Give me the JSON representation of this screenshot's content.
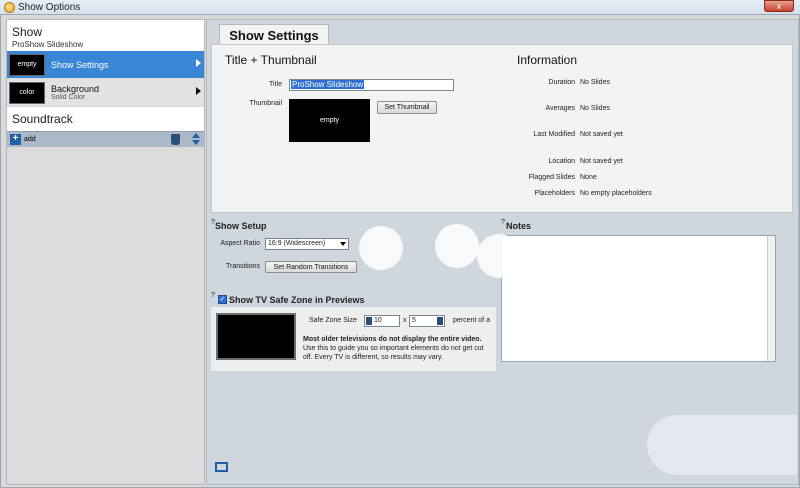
{
  "window": {
    "title": "Show Options",
    "close_label": "x"
  },
  "sidebar": {
    "show": {
      "title": "Show",
      "subtitle": "ProShow Slideshow"
    },
    "items": [
      {
        "thumb": "empty",
        "label": "Show Settings",
        "sub": ""
      },
      {
        "thumb": "color",
        "label": "Background",
        "sub": "Solid Color"
      }
    ],
    "soundtrack": "Soundtrack",
    "add_label": "add"
  },
  "tab": {
    "label": "Show Settings"
  },
  "title_thumb": {
    "heading": "Title + Thumbnail",
    "title_label": "Title",
    "title_value": "ProShow Slideshow",
    "thumbnail_label": "Thumbnail",
    "thumbnail_text": "empty",
    "set_thumbnail_button": "Set Thumbnail"
  },
  "information": {
    "heading": "Information",
    "rows": [
      {
        "label": "Duration",
        "value": "No Slides"
      },
      {
        "label": "Averages",
        "value": "No Slides"
      },
      {
        "label": "Last Modified",
        "value": "Not saved yet"
      },
      {
        "label": "Location",
        "value": "Not saved yet"
      },
      {
        "label": "Flagged Slides",
        "value": "None"
      },
      {
        "label": "Placeholders",
        "value": "No empty placeholders"
      }
    ]
  },
  "setup": {
    "help": "?",
    "heading": "Show Setup",
    "aspect_label": "Aspect Ratio",
    "aspect_value": "16:9 (Widescreen)",
    "transitions_label": "Transitions",
    "random_button": "Set Random Transitions"
  },
  "safe_zone": {
    "help": "?",
    "checkbox_mark": "✓",
    "heading": "Show TV Safe Zone in Previews",
    "size_label": "Safe Zone Size",
    "width_value": "10",
    "x_label": "x",
    "height_value": "5",
    "percent_label": "percent of a",
    "info_bold": "Most older televisions do not display the entire video.",
    "info_text": " Use this to guide you so important elements do not get cut off. Every TV is different, so results may vary."
  },
  "notes": {
    "help": "?",
    "heading": "Notes"
  }
}
